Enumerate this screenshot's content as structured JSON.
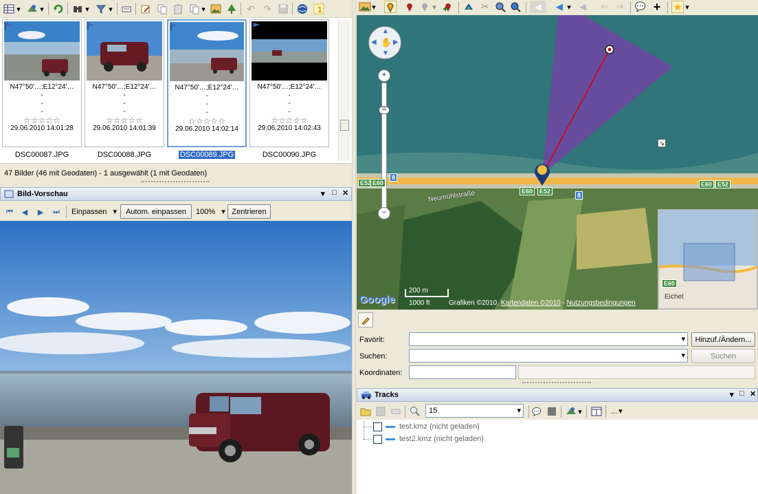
{
  "thumbnails": [
    {
      "coords": "N47°50'…;E12°24'…",
      "dash1": "-",
      "dash2": "-",
      "dash3": "-",
      "date": "29.06.2010 14:01:28",
      "filename": "DSC00087.JPG",
      "stars": "☆☆☆☆☆"
    },
    {
      "coords": "N47°50'…;E12°24'…",
      "dash1": "-",
      "dash2": "-",
      "dash3": "-",
      "date": "29.06.2010 14:01:39",
      "filename": "DSC00088.JPG",
      "stars": "☆☆☆☆☆"
    },
    {
      "coords": "N47°50'…;E12°24'…",
      "dash1": "-",
      "dash2": "-",
      "dash3": "-",
      "date": "29.06.2010 14:02:14",
      "filename": "DSC00089.JPG",
      "stars": "☆☆☆☆☆"
    },
    {
      "coords": "N47°50'…;E12°24'…",
      "dash1": "-",
      "dash2": "-",
      "dash3": "-",
      "date": "29.06.2010 14:02:43",
      "filename": "DSC00090.JPG",
      "stars": "☆☆☆☆☆"
    }
  ],
  "status_text": "47 Bilder (46 mit Geodaten) - 1 ausgewählt (1 mit Geodaten)",
  "preview": {
    "title": "Bild-Vorschau",
    "fit_select": "Einpassen",
    "auto_fit_button": "Autom. einpassen",
    "zoom_select": "100%",
    "center_button": "Zentrieren"
  },
  "map": {
    "scale_m": "200 m",
    "scale_ft": "1000 ft",
    "attribution_a": "Grafiken ©2010, ",
    "attribution_b": "Kartendaten ©2010",
    "attribution_c": " - ",
    "attribution_d": "Nutzungsbedingungen",
    "google_logo": "Google",
    "street_label": "Neumühlstraße",
    "roads": {
      "e52": "E52",
      "e60": "E60",
      "b8": "8"
    },
    "overview_town": "Eichet"
  },
  "form": {
    "favorite_label": "Favorit:",
    "add_change_button": "Hinzuf./Ändern...",
    "search_label": "Suchen:",
    "search_button": "Suchen",
    "coords_label": "Koordinaten:",
    "favorite_value": "",
    "search_value": "",
    "coords_value": ""
  },
  "tracks": {
    "title": "Tracks",
    "count_value": "15",
    "more_label": "...",
    "items": [
      {
        "label": "test.kmz (nicht geladen)"
      },
      {
        "label": "test2.kmz (nicht geladen)"
      }
    ]
  },
  "colors": {
    "accent": "#316ac5",
    "track_line": "#3f8fe0",
    "wedge": "#7a3fa8"
  }
}
